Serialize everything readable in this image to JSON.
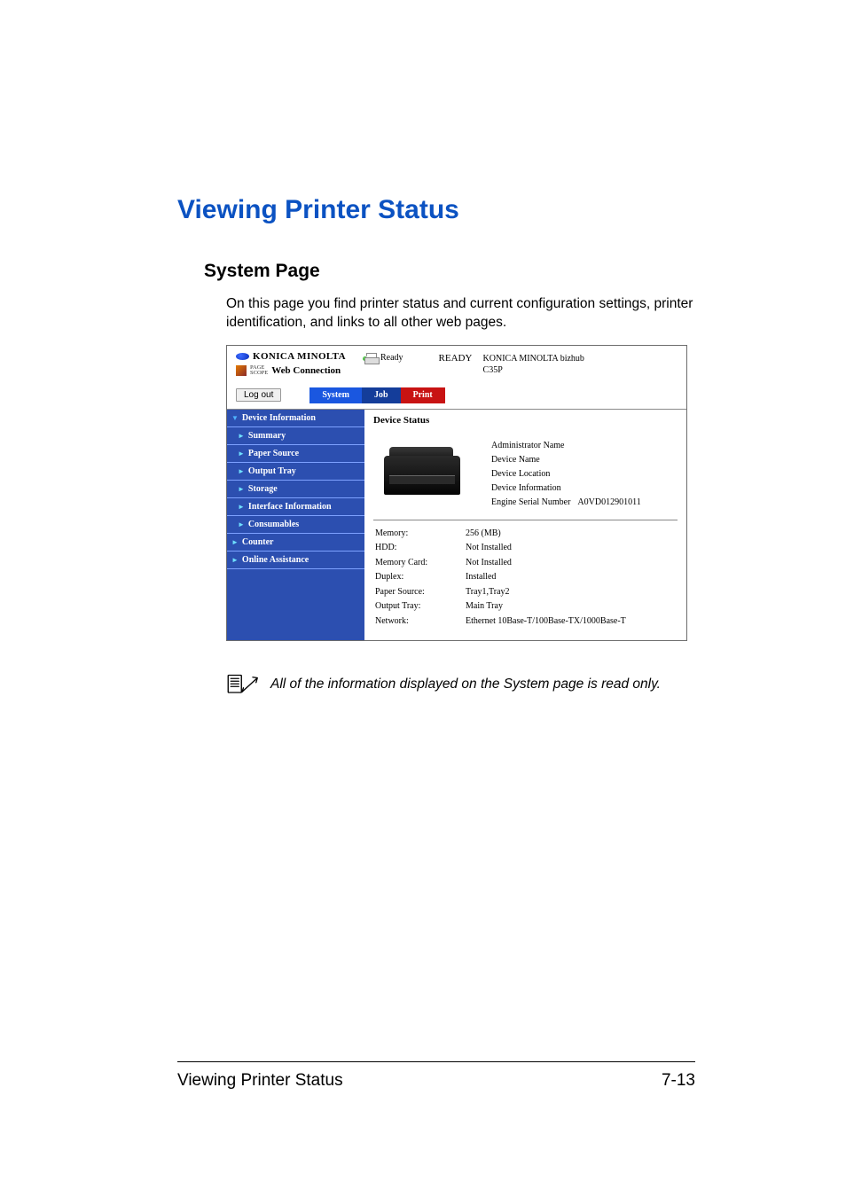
{
  "doc": {
    "title": "Viewing Printer Status",
    "section": "System Page",
    "intro": "On this page you find printer status and current configuration settings, printer identification, and links to all other web pages.",
    "note": "All of the information displayed on the System page is read only.",
    "footer_left": "Viewing Printer Status",
    "footer_right": "7-13"
  },
  "shot": {
    "brand": "KONICA MINOLTA",
    "pagescope_small": "PAGE\nSCOPE",
    "web_connection": "Web Connection",
    "ready_small": "Ready",
    "ready_big": "READY",
    "model_line1": "KONICA MINOLTA bizhub",
    "model_line2": "C35P",
    "logout": "Log out",
    "tabs": {
      "system": "System",
      "job": "Job",
      "print": "Print"
    },
    "nav": {
      "device_info": "Device Information",
      "summary": "Summary",
      "paper_source": "Paper Source",
      "output_tray": "Output Tray",
      "storage": "Storage",
      "interface_info": "Interface Information",
      "consumables": "Consumables",
      "counter": "Counter",
      "online_assistance": "Online Assistance"
    },
    "main": {
      "title": "Device Status",
      "info_rows": [
        {
          "label": "Administrator Name",
          "value": ""
        },
        {
          "label": "Device Name",
          "value": ""
        },
        {
          "label": "Device Location",
          "value": ""
        },
        {
          "label": "Device Information",
          "value": ""
        },
        {
          "label": "Engine Serial Number",
          "value": "A0VD012901011"
        }
      ],
      "spec_rows": [
        {
          "label": "Memory:",
          "value": "256 (MB)"
        },
        {
          "label": "HDD:",
          "value": "Not Installed"
        },
        {
          "label": "Memory Card:",
          "value": "Not Installed"
        },
        {
          "label": "Duplex:",
          "value": "Installed"
        },
        {
          "label": "Paper Source:",
          "value": "Tray1,Tray2"
        },
        {
          "label": "Output Tray:",
          "value": "Main Tray"
        },
        {
          "label": "Network:",
          "value": "Ethernet 10Base-T/100Base-TX/1000Base-T"
        }
      ]
    }
  }
}
